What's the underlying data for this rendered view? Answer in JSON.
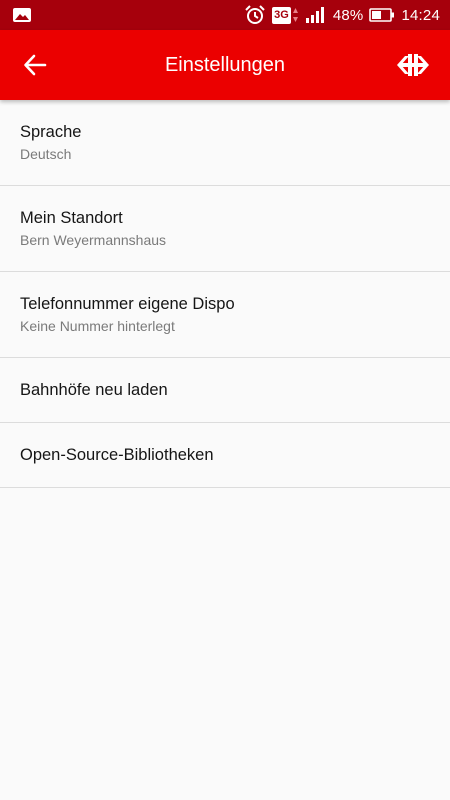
{
  "status_bar": {
    "network": "3G",
    "battery": "48%",
    "time": "14:24",
    "icons": [
      "gallery-icon",
      "alarm-icon",
      "network-3g-icon",
      "signal-icon",
      "battery-icon"
    ]
  },
  "header": {
    "title": "Einstellungen",
    "back_icon": "arrow-left-icon",
    "logo_icon": "sbb-logo-icon"
  },
  "settings": {
    "items": [
      {
        "title": "Sprache",
        "subtitle": "Deutsch"
      },
      {
        "title": "Mein Standort",
        "subtitle": "Bern Weyermannshaus"
      },
      {
        "title": "Telefonnummer eigene Dispo",
        "subtitle": "Keine Nummer hinterlegt"
      },
      {
        "title": "Bahnhöfe neu laden"
      },
      {
        "title": "Open-Source-Bibliotheken"
      }
    ]
  },
  "colors": {
    "status_bar": "#a6000c",
    "app_bar": "#eb0000",
    "background": "#fafafa",
    "divider": "#dcdcdc",
    "primary_text": "#151515",
    "secondary_text": "#7a7a7a"
  }
}
